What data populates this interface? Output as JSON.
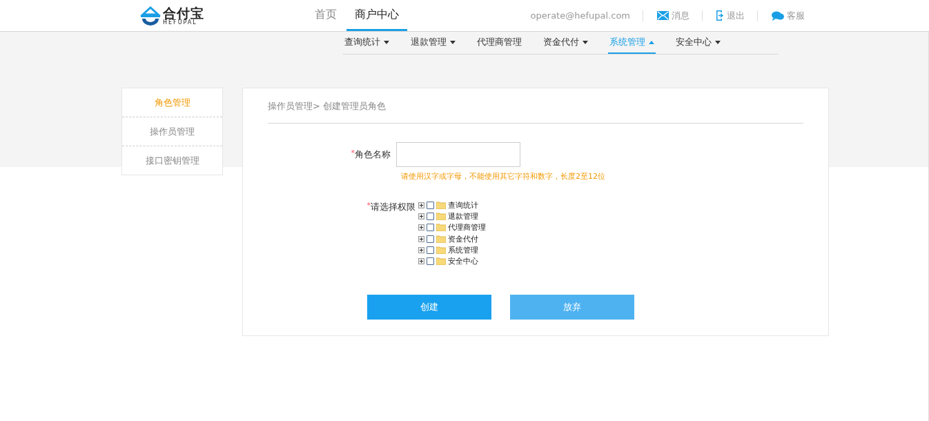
{
  "header": {
    "logo": {
      "name": "合付宝",
      "tagline": "HEFUPAL"
    },
    "nav": [
      {
        "label": "首页",
        "selected": false
      },
      {
        "label": "商户中心",
        "selected": true
      }
    ],
    "account": "operate@hefupal.com",
    "links": [
      {
        "kind": "mail",
        "label": "消息"
      },
      {
        "kind": "exit",
        "label": "退出"
      },
      {
        "kind": "chat",
        "label": "客服"
      }
    ]
  },
  "subnav": [
    {
      "label": "查询统计",
      "dropdown": true,
      "selected": false
    },
    {
      "label": "退款管理",
      "dropdown": true,
      "selected": false
    },
    {
      "label": "代理商管理",
      "dropdown": false,
      "selected": false
    },
    {
      "label": "资金代付",
      "dropdown": true,
      "selected": false
    },
    {
      "label": "系统管理",
      "dropdown": true,
      "selected": true
    },
    {
      "label": "安全中心",
      "dropdown": true,
      "selected": false
    }
  ],
  "sidebar": {
    "items": [
      {
        "label": "角色管理",
        "selected": true
      },
      {
        "label": "操作员管理",
        "selected": false
      },
      {
        "label": "接口密钥管理",
        "selected": false
      }
    ]
  },
  "form": {
    "breadcrumb": "操作员管理> 创建管理员角色",
    "role_name": {
      "label": "角色名称",
      "required_mark": "*",
      "hint": "请使用汉字或字母，不能使用其它字符和数字，长度2至12位"
    },
    "permissions_label": "请选择权限",
    "permissions_required_mark": "*",
    "permissions": [
      {
        "label": "查询统计",
        "checked": false,
        "expanded": false
      },
      {
        "label": "退款管理",
        "checked": false,
        "expanded": false
      },
      {
        "label": "代理商管理",
        "checked": false,
        "expanded": false
      },
      {
        "label": "资金代付",
        "checked": false,
        "expanded": false
      },
      {
        "label": "系统管理",
        "checked": false,
        "expanded": false
      },
      {
        "label": "安全中心",
        "checked": false,
        "expanded": false
      }
    ],
    "buttons": [
      {
        "kind": "primary",
        "label": "创建"
      },
      {
        "kind": "secondary",
        "label": "放弃"
      }
    ]
  }
}
